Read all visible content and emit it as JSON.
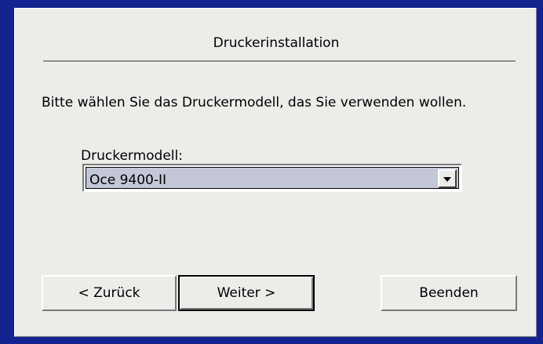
{
  "dialog": {
    "title": "Druckerinstallation",
    "instruction": "Bitte wählen Sie das Druckermodell, das Sie verwenden wollen."
  },
  "printer_model": {
    "label": "Druckermodell:",
    "selected_value": "Oce 9400-II"
  },
  "buttons": {
    "back_label": "< Zurück",
    "next_label": "Weiter >",
    "exit_label": "Beenden"
  },
  "icons": {
    "dropdown": "chevron-down-icon"
  }
}
